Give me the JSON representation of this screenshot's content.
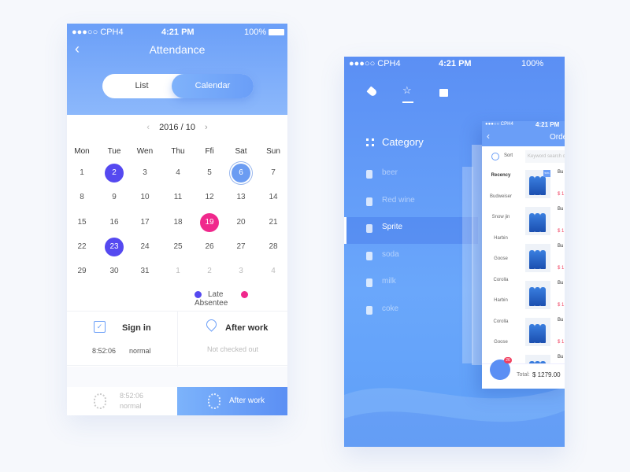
{
  "attendance": {
    "status": {
      "carrier": "●●●○○ CPH4",
      "time": "4:21 PM",
      "battery": "100%"
    },
    "title": "Attendance",
    "tabs": [
      "List",
      "Calendar"
    ],
    "month": "2016 / 10",
    "weekdays": [
      "Mon",
      "Tue",
      "Wen",
      "Thu",
      "Ffi",
      "Sat",
      "Sun"
    ],
    "days": [
      [
        "1",
        "2",
        "3",
        "4",
        "5",
        "6",
        "7"
      ],
      [
        "8",
        "9",
        "10",
        "11",
        "12",
        "13",
        "14"
      ],
      [
        "15",
        "16",
        "17",
        "18",
        "19",
        "20",
        "21"
      ],
      [
        "22",
        "23",
        "24",
        "25",
        "26",
        "27",
        "28"
      ],
      [
        "29",
        "30",
        "31",
        "1",
        "2",
        "3",
        "4"
      ]
    ],
    "legend": {
      "late": "Late",
      "absentee": "Absentee"
    },
    "colors": {
      "late": "#5549f0",
      "absentee": "#f0288c",
      "accent": "#6b9ff8"
    },
    "sign_in": {
      "label": "Sign in",
      "time": "8:52:06",
      "status": "normal"
    },
    "after_work": {
      "label": "After work",
      "status": "Not checked out"
    },
    "bottom": {
      "time": "8:52:06",
      "status": "normal",
      "button": "After work"
    }
  },
  "shop": {
    "status": {
      "carrier": "●●●○○ CPH4",
      "time": "4:21 PM",
      "battery": "100%"
    },
    "tab_icons": [
      "tag-icon",
      "star-icon",
      "bag-icon"
    ],
    "category_title": "Category",
    "categories": [
      "beer",
      "Red wine",
      "Sprite",
      "soda",
      "milk",
      "coke"
    ],
    "selected_category": "Sprite",
    "order": {
      "status": {
        "carrier": "●●●○○ CPH4",
        "time": "4:21 PM"
      },
      "title": "Orde",
      "sort": "Sort",
      "search_placeholder": "Keyword search c",
      "filters": [
        "Recency",
        "Budweiser",
        "Snow jin",
        "Harbin",
        "Goose",
        "Corolla",
        "Harbin",
        "Corolla",
        "Goose"
      ],
      "product_name": "Bu",
      "product_price": "$ 1",
      "badge": "50%",
      "cart_count": "26",
      "total_label": "Total:",
      "total": "$ 1279.00"
    }
  }
}
